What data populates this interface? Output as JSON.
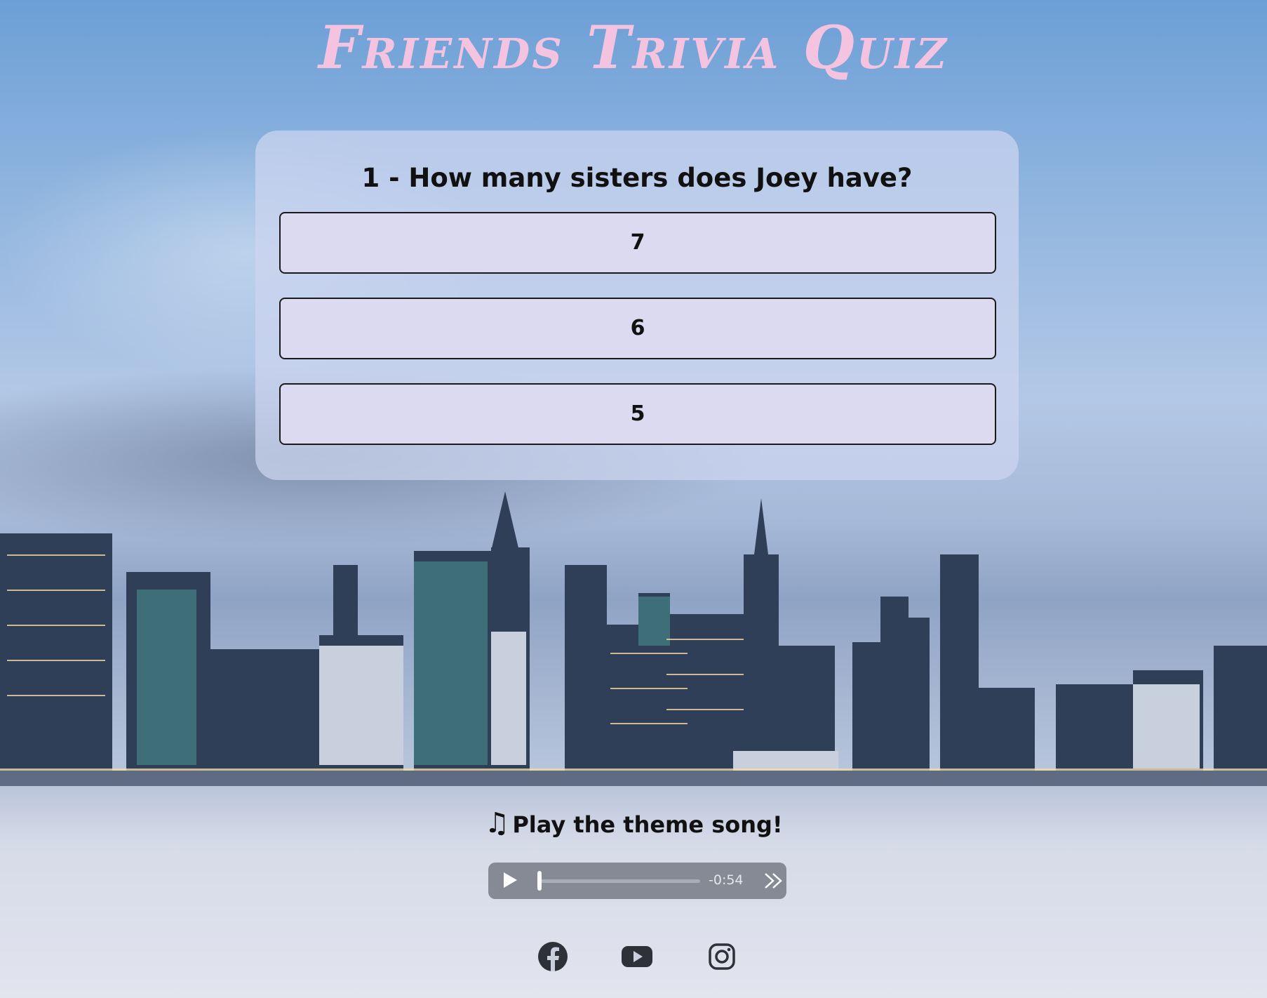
{
  "page": {
    "title": "Friends Trivia Quiz"
  },
  "quiz": {
    "question": "1 - How many sisters does Joey have?",
    "answers": [
      "7",
      "6",
      "5"
    ]
  },
  "audio": {
    "prompt_icon": "♫",
    "prompt": "Play the theme song!",
    "time_remaining": "-0:54",
    "progress": 0.0
  },
  "social": {
    "icons": [
      "facebook-icon",
      "youtube-icon",
      "instagram-icon"
    ]
  },
  "colors": {
    "title": "#f3c3df",
    "card": "#cdd6f0",
    "answer_bg": "#dcdaf0"
  }
}
